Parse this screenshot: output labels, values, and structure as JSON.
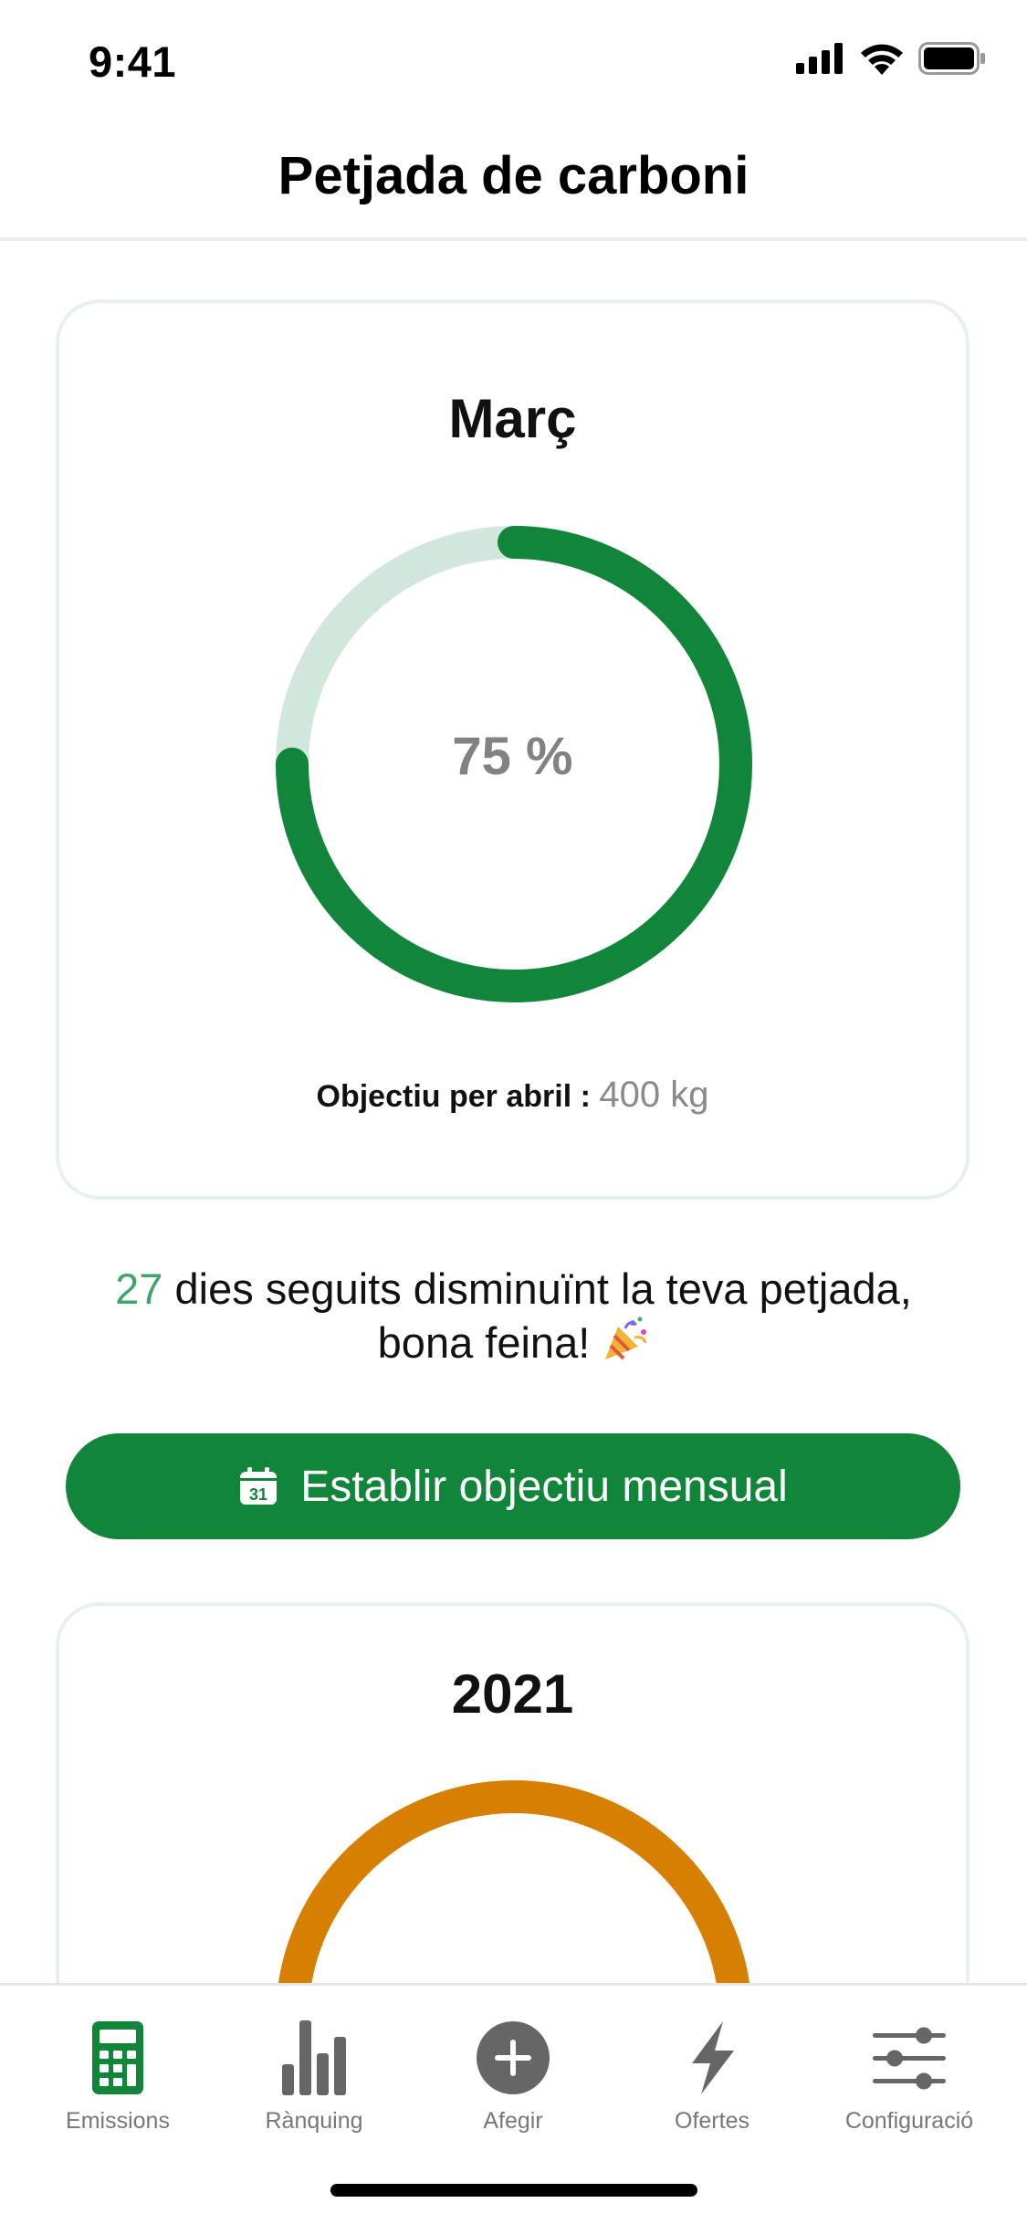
{
  "status_bar": {
    "time": "9:41"
  },
  "header": {
    "title": "Petjada de carboni"
  },
  "monthly_card": {
    "title": "Març",
    "progress_label": "75 %",
    "progress_fraction": 0.75,
    "goal_label": "Objectiu per abril :",
    "goal_value": "400 kg"
  },
  "streak": {
    "count": "27",
    "message_line1": " dies seguits disminuïnt la teva petjada,",
    "message_line2": "bona feina!"
  },
  "set_goal_button": {
    "label": "Establir objectiu mensual",
    "icon": "calendar-icon",
    "icon_day": "31"
  },
  "yearly_card": {
    "title": "2021"
  },
  "colors": {
    "primary_green": "#11863b",
    "ring_track": "#d2e7dc",
    "year_orange": "#d77f00",
    "streak_green": "#3fa66a"
  },
  "tab_bar": {
    "items": [
      {
        "label": "Emissions",
        "icon": "calculator-icon",
        "active": true
      },
      {
        "label": "Rànquing",
        "icon": "bar-chart-icon",
        "active": false
      },
      {
        "label": "Afegir",
        "icon": "plus-circle-icon",
        "active": false
      },
      {
        "label": "Ofertes",
        "icon": "lightning-icon",
        "active": false
      },
      {
        "label": "Configuració",
        "icon": "sliders-icon",
        "active": false
      }
    ]
  }
}
